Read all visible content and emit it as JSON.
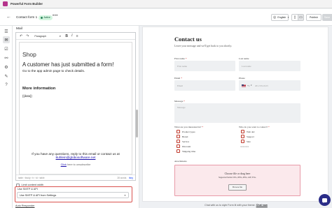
{
  "app": {
    "title": "Powerful Form Builder"
  },
  "toolbar": {
    "form_name": "Contact form 1",
    "status_badge": "Active",
    "more_label": "•••",
    "language": "English",
    "publish_label": "Publish",
    "save_label": "Save"
  },
  "rail": {
    "icons": [
      "list-icon",
      "email-icon",
      "checkout-icon",
      "integrations-icon",
      "settings-icon",
      "design-icon",
      "help-icon"
    ],
    "selected": "email-icon"
  },
  "panel": {
    "title": "Mail",
    "editor": {
      "paragraph_select": "Paragraph",
      "content": {
        "shop": "Shop",
        "headline": "A customer has just submitted a form!",
        "subline": "Go to the app admin page to check details.",
        "more_info": "More information",
        "data_token": "{{data}}"
      },
      "footer": {
        "line1": "If you have any questions, reply to this email or contact us at",
        "email": "8uhlein@globosoftware.net",
        "unsub_link": "Click",
        "unsub_rest": "here to unsubscribe"
      },
      "status_path": "table › tbody › tr › td › table",
      "word_count": "28 words",
      "brand": "tiny"
    },
    "limit_label": "Limit content width",
    "smtp": {
      "label": "Use SMTP & API",
      "value": "Use SMTP & API from Settings"
    },
    "auto_responder": "Auto Responder"
  },
  "preview": {
    "title": "Contact us",
    "subtitle": "Leave your message and we'll get back to you shortly.",
    "first_name": {
      "label": "First name",
      "placeholder": "First name"
    },
    "last_name": {
      "label": "Last name",
      "placeholder": "Last name"
    },
    "email": {
      "label": "Email",
      "placeholder": "Email"
    },
    "phone": {
      "label": "Phone",
      "dial_code": "+1",
      "placeholder": "201-555-0123"
    },
    "message": {
      "label": "Message",
      "placeholder": "Message"
    },
    "interested": {
      "label": "What are you interested in?",
      "options": [
        "Product types",
        "Brand",
        "Service",
        "Discount",
        "Shipping time"
      ]
    },
    "contact_who": {
      "label": "Who do you want to contact?",
      "options": [
        "Web dev",
        "Support",
        "Sale"
      ],
      "trailing": "xxxxxxx"
    },
    "attachments": {
      "label": "Attachments",
      "title": "Choose file or drag here",
      "supported": "Supported format: JPG, JPEG, PNG, GIF, SVG.",
      "browse_label": "Browse file"
    },
    "chat_bar": {
      "text": "Chat with us to style Form lit with your theme.",
      "link": "Chat now"
    }
  },
  "colors": {
    "accent_red": "#d9534f",
    "badge_green": "#d3f5df",
    "fab_navy": "#2b2d88",
    "checkbox_red": "#c0392b",
    "upload_pink": "#fbe9ec"
  }
}
